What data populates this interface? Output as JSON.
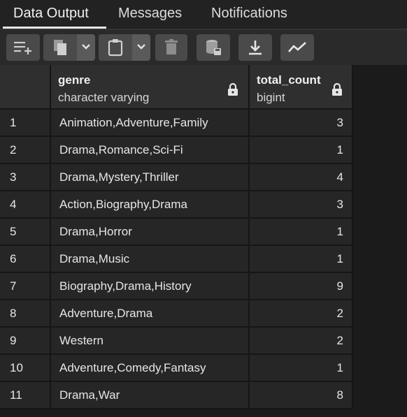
{
  "tabs": [
    {
      "label": "Data Output",
      "active": true
    },
    {
      "label": "Messages",
      "active": false
    },
    {
      "label": "Notifications",
      "active": false
    }
  ],
  "toolbar": {
    "buttons": [
      "add-row-icon",
      "copy-icon",
      "chevron-down-icon",
      "paste-icon",
      "chevron-down-icon",
      "delete-icon",
      "save-data-icon",
      "download-icon",
      "graph-icon"
    ]
  },
  "grid": {
    "columns": [
      {
        "name": "genre",
        "type": "character varying"
      },
      {
        "name": "total_count",
        "type": "bigint"
      }
    ],
    "rows": [
      {
        "num": "1",
        "genre": "Animation,Adventure,Family",
        "total_count": "3"
      },
      {
        "num": "2",
        "genre": "Drama,Romance,Sci-Fi",
        "total_count": "1"
      },
      {
        "num": "3",
        "genre": "Drama,Mystery,Thriller",
        "total_count": "4"
      },
      {
        "num": "4",
        "genre": "Action,Biography,Drama",
        "total_count": "3"
      },
      {
        "num": "5",
        "genre": "Drama,Horror",
        "total_count": "1"
      },
      {
        "num": "6",
        "genre": "Drama,Music",
        "total_count": "1"
      },
      {
        "num": "7",
        "genre": "Biography,Drama,History",
        "total_count": "9"
      },
      {
        "num": "8",
        "genre": "Adventure,Drama",
        "total_count": "2"
      },
      {
        "num": "9",
        "genre": "Western",
        "total_count": "2"
      },
      {
        "num": "10",
        "genre": "Adventure,Comedy,Fantasy",
        "total_count": "1"
      },
      {
        "num": "11",
        "genre": "Drama,War",
        "total_count": "8"
      }
    ]
  },
  "colors": {
    "background": "#222222",
    "cell": "#262626",
    "header": "#2f2f2f",
    "button": "#4a4a4a"
  }
}
